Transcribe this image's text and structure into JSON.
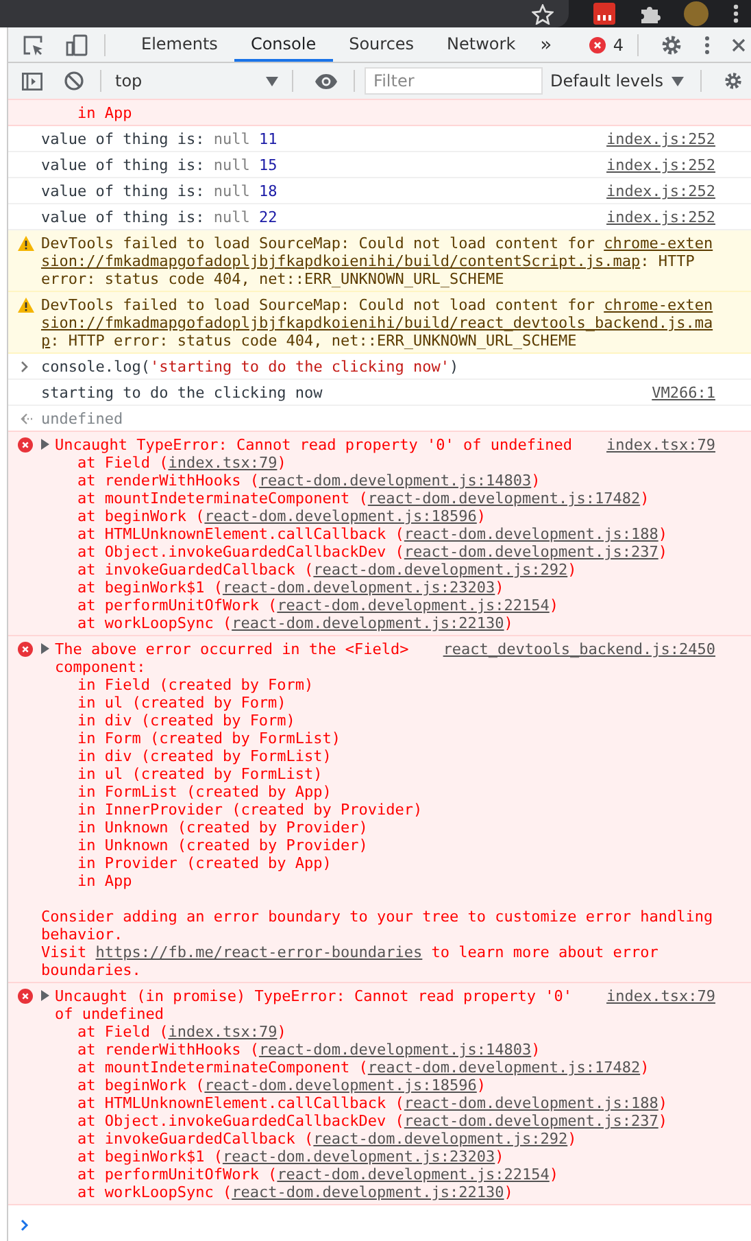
{
  "tabs": [
    {
      "label": "Elements",
      "selected": false
    },
    {
      "label": "Console",
      "selected": true
    },
    {
      "label": "Sources",
      "selected": false
    },
    {
      "label": "Network",
      "selected": false
    }
  ],
  "more_tabs": "»",
  "error_count": "4",
  "toolbar": {
    "context": "top",
    "filter": {
      "placeholder": "Filter"
    },
    "levels": "Default levels"
  },
  "messages": [
    {
      "kind": "error",
      "stack": [
        [
          {
            "text": "in App"
          }
        ]
      ]
    },
    {
      "kind": "log",
      "text": [
        {
          "text": "value of thing is: "
        },
        {
          "text": "null",
          "kind": "null"
        },
        {
          "text": " 11",
          "kind": "number"
        }
      ],
      "source": "index.js:252"
    },
    {
      "kind": "log",
      "text": [
        {
          "text": "value of thing is: "
        },
        {
          "text": "null",
          "kind": "null"
        },
        {
          "text": " 15",
          "kind": "number"
        }
      ],
      "source": "index.js:252"
    },
    {
      "kind": "log",
      "text": [
        {
          "text": "value of thing is: "
        },
        {
          "text": "null",
          "kind": "null"
        },
        {
          "text": " 18",
          "kind": "number"
        }
      ],
      "source": "index.js:252"
    },
    {
      "kind": "log",
      "text": [
        {
          "text": "value of thing is: "
        },
        {
          "text": "null",
          "kind": "null"
        },
        {
          "text": " 22",
          "kind": "number"
        }
      ],
      "source": "index.js:252"
    },
    {
      "kind": "warning",
      "text": [
        {
          "text": "DevTools failed to load SourceMap: Could not load content for "
        },
        {
          "text": "chrome-extension://fmkadmapgofadopljbjfkapdkoienihi/build/contentScript.js.map",
          "kind": "link"
        },
        {
          "text": ": HTTP error: status code 404, net::ERR_UNKNOWN_URL_SCHEME"
        }
      ]
    },
    {
      "kind": "warning",
      "text": [
        {
          "text": "DevTools failed to load SourceMap: Could not load content for "
        },
        {
          "text": "chrome-extension://fmkadmapgofadopljbjfkapdkoienihi/build/react_devtools_backend.js.map",
          "kind": "link"
        },
        {
          "text": ": HTTP error: status code 404, net::ERR_UNKNOWN_URL_SCHEME"
        }
      ]
    },
    {
      "kind": "command",
      "text": [
        {
          "text": "console.log("
        },
        {
          "text": "'starting to do the clicking now'",
          "kind": "string"
        },
        {
          "text": ")"
        }
      ]
    },
    {
      "kind": "log",
      "text": [
        {
          "text": "starting to do the clicking now"
        }
      ],
      "source": "VM266:1"
    },
    {
      "kind": "result",
      "text": [
        {
          "text": "undefined",
          "kind": "undefined"
        }
      ]
    },
    {
      "kind": "error",
      "expanded": false,
      "header": [
        {
          "text": "Uncaught TypeError: Cannot read property '0' of undefined"
        }
      ],
      "source": "index.tsx:79",
      "stack": [
        [
          {
            "text": "at Field ("
          },
          {
            "text": "index.tsx:79",
            "kind": "link"
          },
          {
            "text": ")"
          }
        ],
        [
          {
            "text": "at renderWithHooks ("
          },
          {
            "text": "react-dom.development.js:14803",
            "kind": "link"
          },
          {
            "text": ")"
          }
        ],
        [
          {
            "text": "at mountIndeterminateComponent ("
          },
          {
            "text": "react-dom.development.js:17482",
            "kind": "link"
          },
          {
            "text": ")"
          }
        ],
        [
          {
            "text": "at beginWork ("
          },
          {
            "text": "react-dom.development.js:18596",
            "kind": "link"
          },
          {
            "text": ")"
          }
        ],
        [
          {
            "text": "at HTMLUnknownElement.callCallback ("
          },
          {
            "text": "react-dom.development.js:188",
            "kind": "link"
          },
          {
            "text": ")"
          }
        ],
        [
          {
            "text": "at Object.invokeGuardedCallbackDev ("
          },
          {
            "text": "react-dom.development.js:237",
            "kind": "link"
          },
          {
            "text": ")"
          }
        ],
        [
          {
            "text": "at invokeGuardedCallback ("
          },
          {
            "text": "react-dom.development.js:292",
            "kind": "link"
          },
          {
            "text": ")"
          }
        ],
        [
          {
            "text": "at beginWork$1 ("
          },
          {
            "text": "react-dom.development.js:23203",
            "kind": "link"
          },
          {
            "text": ")"
          }
        ],
        [
          {
            "text": "at performUnitOfWork ("
          },
          {
            "text": "react-dom.development.js:22154",
            "kind": "link"
          },
          {
            "text": ")"
          }
        ],
        [
          {
            "text": "at workLoopSync ("
          },
          {
            "text": "react-dom.development.js:22130",
            "kind": "link"
          },
          {
            "text": ")"
          }
        ]
      ]
    },
    {
      "kind": "error",
      "expanded": false,
      "header": [
        {
          "text": "The above error occurred in the <Field> component:"
        }
      ],
      "source": "react_devtools_backend.js:2450",
      "stack": [
        [
          {
            "text": "in Field (created by Form)"
          }
        ],
        [
          {
            "text": "in ul (created by Form)"
          }
        ],
        [
          {
            "text": "in div (created by Form)"
          }
        ],
        [
          {
            "text": "in Form (created by FormList)"
          }
        ],
        [
          {
            "text": "in div (created by FormList)"
          }
        ],
        [
          {
            "text": "in ul (created by FormList)"
          }
        ],
        [
          {
            "text": "in FormList (created by App)"
          }
        ],
        [
          {
            "text": "in InnerProvider (created by Provider)"
          }
        ],
        [
          {
            "text": "in Unknown (created by Provider)"
          }
        ],
        [
          {
            "text": "in Unknown (created by Provider)"
          }
        ],
        [
          {
            "text": "in Provider (created by App)"
          }
        ],
        [
          {
            "text": "in App"
          }
        ]
      ],
      "notes": [
        [
          {
            "text": "Consider adding an error boundary to your tree to customize error handling behavior."
          }
        ],
        [
          {
            "text": "Visit "
          },
          {
            "text": "https://fb.me/react-error-boundaries",
            "kind": "link"
          },
          {
            "text": " to learn more about error boundaries."
          }
        ]
      ]
    },
    {
      "kind": "error",
      "expanded": false,
      "header": [
        {
          "text": "Uncaught (in promise) TypeError: Cannot read property '0' of undefined"
        }
      ],
      "source": "index.tsx:79",
      "stack": [
        [
          {
            "text": "at Field ("
          },
          {
            "text": "index.tsx:79",
            "kind": "link"
          },
          {
            "text": ")"
          }
        ],
        [
          {
            "text": "at renderWithHooks ("
          },
          {
            "text": "react-dom.development.js:14803",
            "kind": "link"
          },
          {
            "text": ")"
          }
        ],
        [
          {
            "text": "at mountIndeterminateComponent ("
          },
          {
            "text": "react-dom.development.js:17482",
            "kind": "link"
          },
          {
            "text": ")"
          }
        ],
        [
          {
            "text": "at beginWork ("
          },
          {
            "text": "react-dom.development.js:18596",
            "kind": "link"
          },
          {
            "text": ")"
          }
        ],
        [
          {
            "text": "at HTMLUnknownElement.callCallback ("
          },
          {
            "text": "react-dom.development.js:188",
            "kind": "link"
          },
          {
            "text": ")"
          }
        ],
        [
          {
            "text": "at Object.invokeGuardedCallbackDev ("
          },
          {
            "text": "react-dom.development.js:237",
            "kind": "link"
          },
          {
            "text": ")"
          }
        ],
        [
          {
            "text": "at invokeGuardedCallback ("
          },
          {
            "text": "react-dom.development.js:292",
            "kind": "link"
          },
          {
            "text": ")"
          }
        ],
        [
          {
            "text": "at beginWork$1 ("
          },
          {
            "text": "react-dom.development.js:23203",
            "kind": "link"
          },
          {
            "text": ")"
          }
        ],
        [
          {
            "text": "at performUnitOfWork ("
          },
          {
            "text": "react-dom.development.js:22154",
            "kind": "link"
          },
          {
            "text": ")"
          }
        ],
        [
          {
            "text": "at workLoopSync ("
          },
          {
            "text": "react-dom.development.js:22130",
            "kind": "link"
          },
          {
            "text": ")"
          }
        ]
      ]
    }
  ]
}
